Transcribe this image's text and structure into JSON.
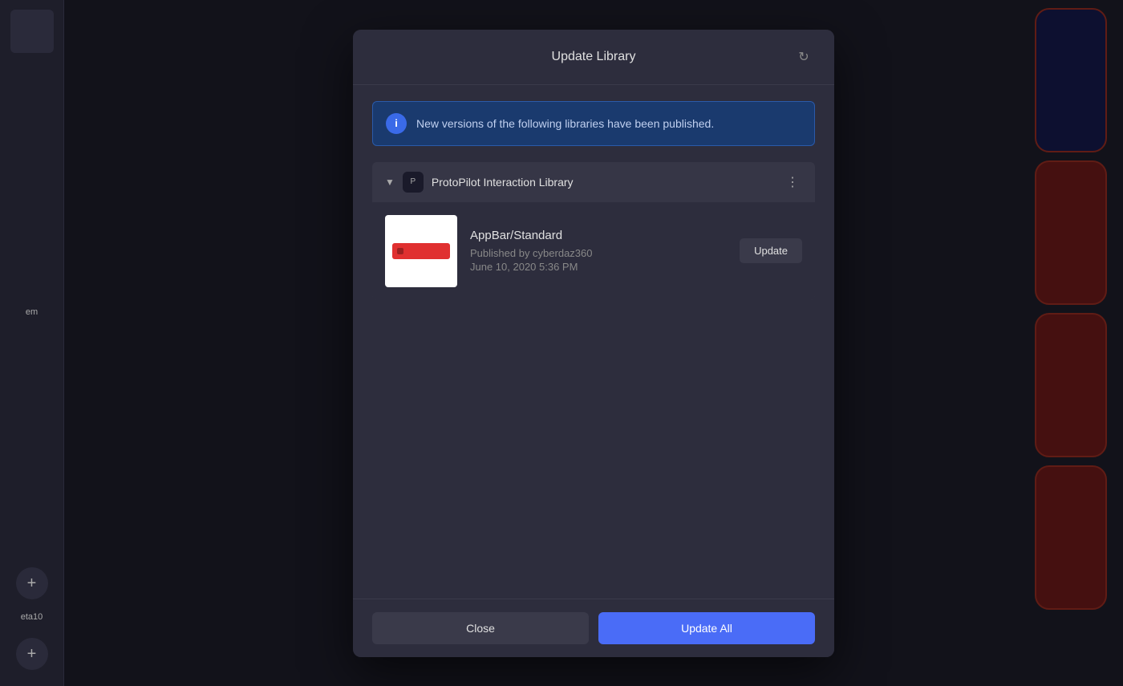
{
  "modal": {
    "title": "Update Library",
    "refresh_label": "↻",
    "info_banner": {
      "text": "New versions of the following libraries have been published.",
      "icon": "i"
    },
    "library": {
      "name": "ProtoPilot Interaction Library",
      "avatar_text": "P"
    },
    "component": {
      "name": "AppBar/Standard",
      "publisher_label": "Published by cyberdaz360",
      "date": "June 10, 2020 5:36 PM",
      "update_button": "Update"
    },
    "footer": {
      "close_label": "Close",
      "update_all_label": "Update All"
    }
  },
  "sidebar": {
    "add_label": "+",
    "page_labels": [
      "em",
      "eta10"
    ]
  },
  "icons": {
    "chevron_down": "▼",
    "more_vert": "⋮"
  }
}
